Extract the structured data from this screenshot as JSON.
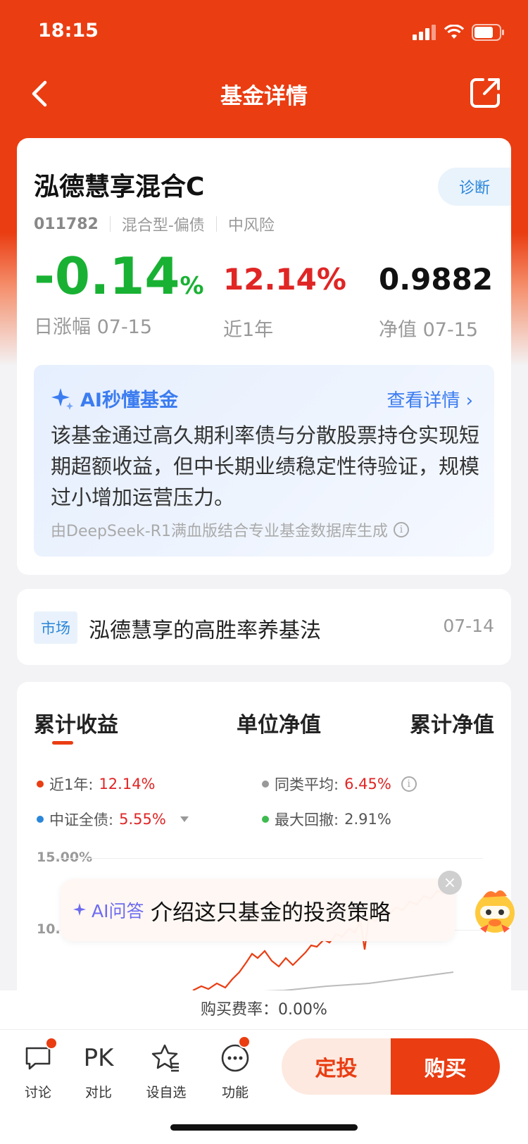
{
  "status": {
    "time": "18:15"
  },
  "nav": {
    "title": "基金详情"
  },
  "fund": {
    "name": "泓德慧享混合C",
    "diagnose_label": "诊断",
    "code": "011782",
    "type": "混合型-偏债",
    "risk": "中风险",
    "daily_change": "-0.14",
    "daily_change_unit": "%",
    "daily_change_label": "日涨幅 07-15",
    "year_return": "12.14%",
    "year_return_label": "近1年",
    "nav_value": "0.9882",
    "nav_label": "净值 07-15"
  },
  "ai_summary": {
    "title": "AI秒懂基金",
    "more_label": "查看详情",
    "text": "该基金通过高久期利率债与分散股票持仓实现短期超额收益，但中长期业绩稳定性待验证，规模过小增加运营压力。",
    "note": "由DeepSeek-R1满血版结合专业基金数据库生成"
  },
  "news": {
    "tag": "市场",
    "title": "泓德慧享的高胜率养基法",
    "date": "07-14"
  },
  "chart": {
    "tabs": [
      "累计收益",
      "单位净值",
      "累计净值"
    ],
    "legend": [
      {
        "label": "近1年:",
        "value": "12.14%",
        "color": "#ea3d12"
      },
      {
        "label": "同类平均:",
        "value": "6.45%",
        "color": "#999999"
      },
      {
        "label": "中证全债:",
        "value": "5.55%",
        "color": "#2a86d8"
      },
      {
        "label": "最大回撤:",
        "value": "2.91%",
        "color": "#3dbb4f"
      }
    ],
    "y_ticks": [
      "15.00%",
      "10."
    ]
  },
  "ai_ask": {
    "tag": "AI问答",
    "text": "介绍这只基金的投资策略"
  },
  "fee": {
    "text": "购买费率：0.00%"
  },
  "bottom": {
    "tools": [
      {
        "label": "讨论",
        "icon": "chat-icon"
      },
      {
        "label": "对比",
        "icon": "pk-icon",
        "glyph": "PK"
      },
      {
        "label": "设自选",
        "icon": "star-list-icon"
      },
      {
        "label": "功能",
        "icon": "more-icon"
      }
    ],
    "dingtou_label": "定投",
    "buy_label": "购买"
  },
  "colors": {
    "brand": "#ea3d12",
    "up": "#e02525",
    "down": "#19b133",
    "ai_blue": "#3b7cf0"
  }
}
